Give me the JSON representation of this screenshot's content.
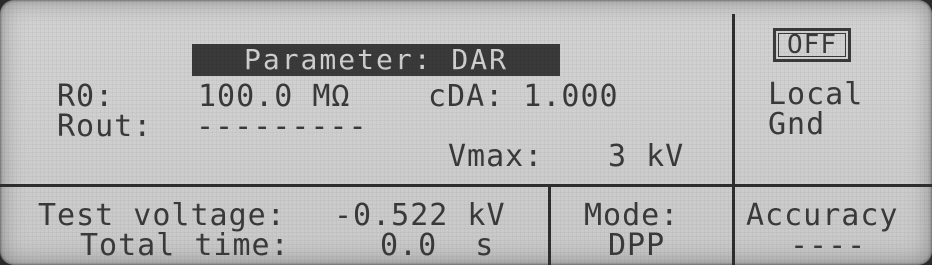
{
  "parameter_banner": "Parameter: DAR",
  "r0": {
    "label": "R0:",
    "value": "100.0 MΩ"
  },
  "cda": "cDA: 1.000",
  "rout": {
    "label": "Rout:",
    "value": "---------"
  },
  "vmax": {
    "label": "Vmax:",
    "value": "3 kV"
  },
  "status": {
    "output": "OFF",
    "local": "Local",
    "gnd": "Gnd"
  },
  "bottom": {
    "test_voltage_label": "Test voltage:",
    "test_voltage_value": "-0.522 kV",
    "total_time_label": "Total time:",
    "total_time_value": "0.0  s",
    "mode_label": "Mode:",
    "mode_value": "DPP",
    "accuracy_label": "Accuracy",
    "accuracy_value": "----"
  }
}
